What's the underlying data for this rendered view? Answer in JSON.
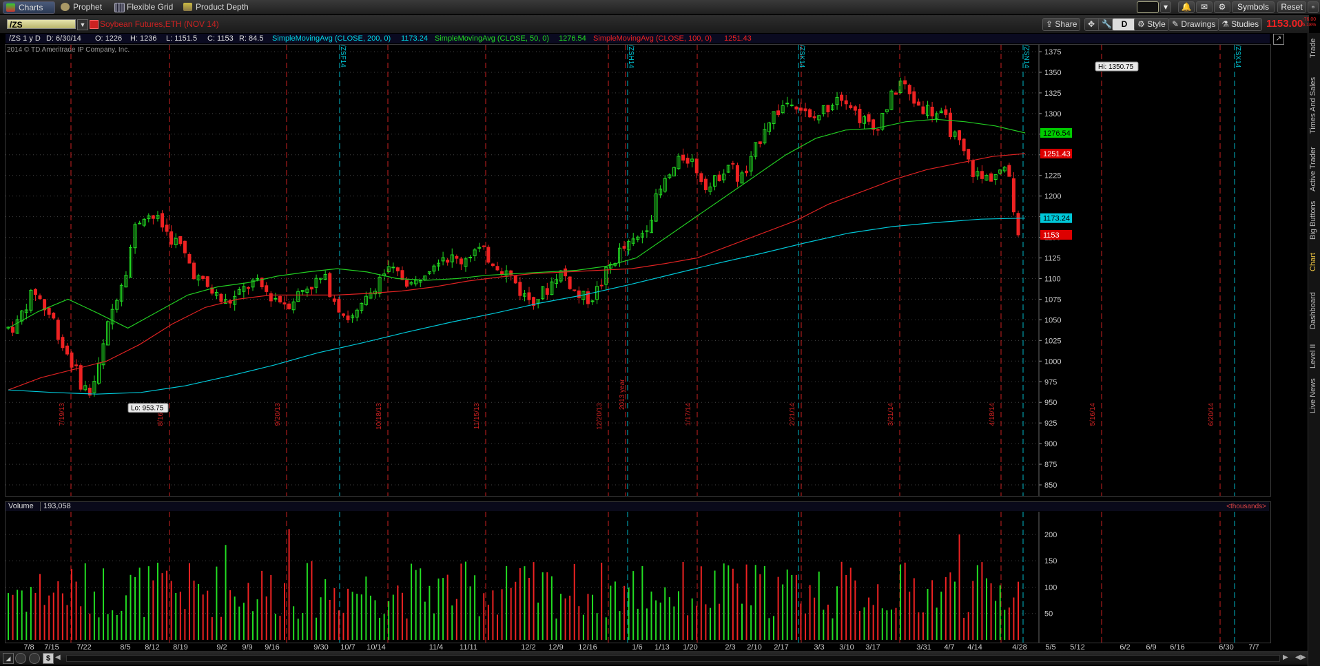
{
  "toolbar": {
    "tabs": [
      "Charts",
      "Prophet",
      "Flexible Grid",
      "Product Depth"
    ],
    "symbols_label": "Symbols",
    "reset_label": "Reset"
  },
  "header": {
    "symbol": "/ZS",
    "description": "Soybean Futures,ETH (NOV 14)",
    "share": "Share",
    "d_label": "D",
    "style": "Style",
    "drawings": "Drawings",
    "studies": "Studies",
    "last_price": "1153.00",
    "change": "-76.00",
    "change_pct": "-6.18%"
  },
  "studies": {
    "title": "/ZS 1 y D",
    "d": "D: 6/30/14",
    "o": "O: 1226",
    "h": "H: 1236",
    "l": "L: 1151.5",
    "c": "C: 1153",
    "r": "R: 84.5",
    "sma200": "SimpleMovingAvg (CLOSE, 200, 0)",
    "sma200_val": "1173.24",
    "sma50": "SimpleMovingAvg (CLOSE, 50, 0)",
    "sma50_val": "1276.54",
    "sma100": "SimpleMovingAvg (CLOSE, 100, 0)",
    "sma100_val": "1251.43"
  },
  "chart_data": {
    "type": "line",
    "copyright": "2014 © TD Ameritrade IP Company, Inc.",
    "price_ylim": [
      840,
      1380
    ],
    "price_ticks": [
      850,
      875,
      900,
      925,
      950,
      975,
      1000,
      1025,
      1050,
      1075,
      1100,
      1125,
      1150,
      1175,
      1200,
      1225,
      1250,
      1275,
      1300,
      1325,
      1350,
      1375
    ],
    "hi_label": "Hi: 1350.75",
    "lo_label": "Lo: 953.75",
    "badges": [
      {
        "value": "1276.54",
        "color": "#00cc00"
      },
      {
        "value": "1251.43",
        "color": "#dd0000"
      },
      {
        "value": "1173.24",
        "color": "#00c8d8"
      },
      {
        "value": "1153",
        "color": "#dd0000"
      }
    ],
    "x_ticks": [
      "7/8",
      "7/15",
      "7/22",
      "8/5",
      "8/12",
      "8/19",
      "9/2",
      "9/9",
      "9/16",
      "9/30",
      "10/7",
      "10/14",
      "11/4",
      "11/11",
      "12/2",
      "12/9",
      "12/16",
      "1/6",
      "1/13",
      "1/20",
      "2/3",
      "2/10",
      "2/17",
      "3/3",
      "3/10",
      "3/17",
      "3/31",
      "4/7",
      "4/14",
      "4/28",
      "5/5",
      "5/12",
      "6/2",
      "6/9",
      "6/16",
      "6/30",
      "7/7"
    ],
    "month_marks": [
      "7/19/13",
      "8/16/13",
      "9/20/13",
      "10/18/13",
      "11/15/13",
      "12/20/13",
      "1/17/14",
      "2/21/14",
      "3/21/14",
      "4/18/14",
      "5/16/14",
      "6/20/14"
    ],
    "expiry_marks": [
      "/ZSF14",
      "/ZSH14",
      "/ZSK14",
      "/ZSN14",
      "/ZSX14"
    ],
    "year_mark": "2013 year",
    "series": [
      {
        "name": "SimpleMovingAvg (CLOSE, 50, 0)",
        "color": "#22cc22",
        "values": [
          1040,
          1060,
          1075,
          1058,
          1040,
          1060,
          1080,
          1090,
          1095,
          1103,
          1108,
          1112,
          1108,
          1100,
          1098,
          1100,
          1104,
          1106,
          1108,
          1110,
          1115,
          1125,
          1150,
          1175,
          1200,
          1225,
          1250,
          1270,
          1280,
          1282,
          1290,
          1293,
          1290,
          1285,
          1276.54
        ]
      },
      {
        "name": "SimpleMovingAvg (CLOSE, 100, 0)",
        "color": "#dd2222",
        "values": [
          965,
          980,
          990,
          1000,
          1020,
          1045,
          1065,
          1075,
          1080,
          1080,
          1080,
          1082,
          1085,
          1090,
          1097,
          1102,
          1106,
          1108,
          1110,
          1112,
          1118,
          1125,
          1140,
          1155,
          1170,
          1190,
          1205,
          1220,
          1232,
          1240,
          1248,
          1251.43
        ]
      },
      {
        "name": "SimpleMovingAvg (CLOSE, 200, 0)",
        "color": "#00c8d8",
        "values": [
          965,
          962,
          960,
          962,
          970,
          982,
          995,
          1010,
          1022,
          1035,
          1047,
          1058,
          1070,
          1080,
          1092,
          1105,
          1118,
          1130,
          1143,
          1155,
          1163,
          1168,
          1172,
          1173.24
        ]
      }
    ],
    "volume_ticks": [
      50,
      100,
      150,
      200
    ],
    "volume_label": "Volume",
    "volume_value": "193,058",
    "volume_units": "<thousands>"
  },
  "sidebar": [
    "Trade",
    "Times And Sales",
    "Active Trader",
    "Big Buttons",
    "Chart",
    "Dashboard",
    "Level II",
    "Live News"
  ]
}
